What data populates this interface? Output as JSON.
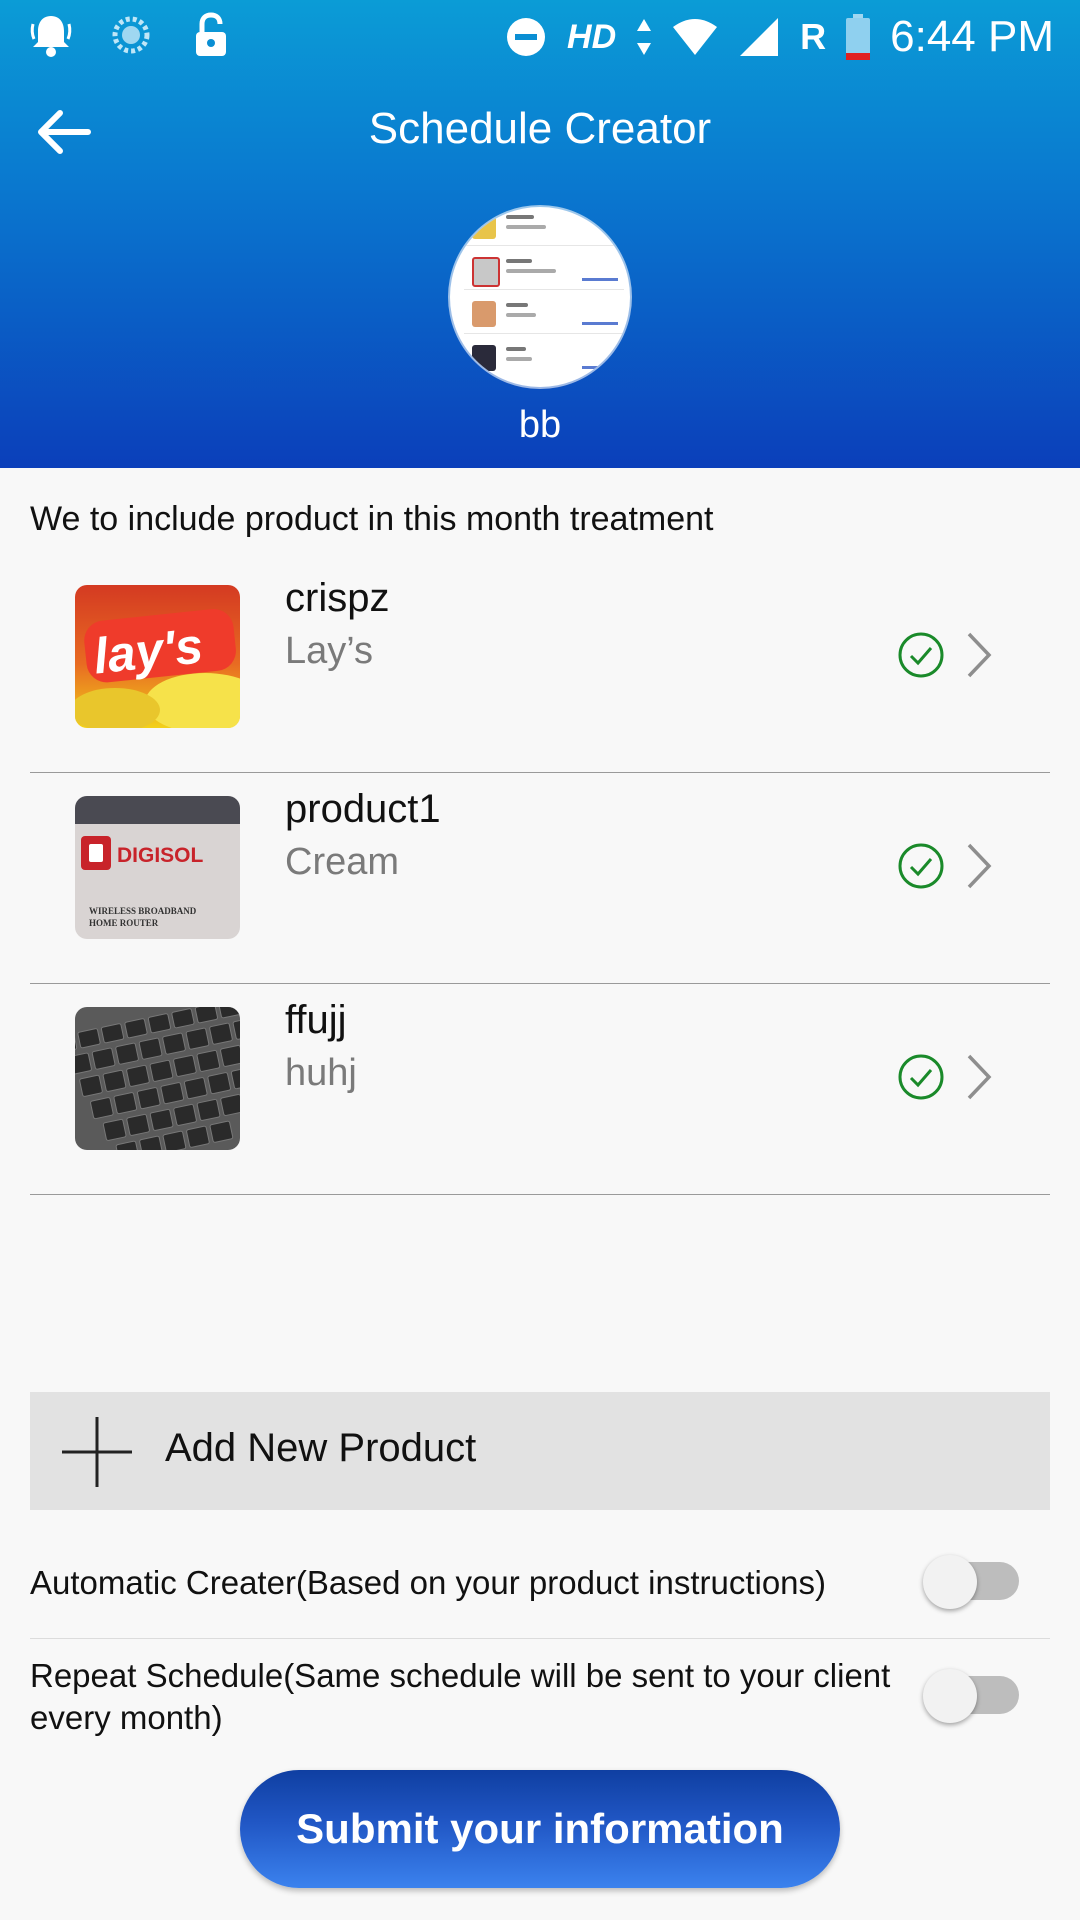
{
  "status_bar": {
    "hd_label": "HD",
    "roaming_label": "R",
    "time": "6:44 PM",
    "icons": [
      "notification-bell-icon",
      "sync-icon",
      "lock-icon",
      "do-not-disturb-icon",
      "data-arrows-icon",
      "wifi-icon",
      "signal-icon",
      "battery-icon"
    ]
  },
  "toolbar": {
    "title": "Schedule Creator",
    "back_icon": "arrow-left-icon"
  },
  "profile": {
    "username": "bb"
  },
  "intro_text": "We to include product in this month treatment",
  "products": [
    {
      "name": "crispz",
      "brand": "Lay’s",
      "selected": true,
      "status_icon": "check-circle-icon",
      "accent": "#e0302a"
    },
    {
      "name": "product1",
      "brand": "Cream",
      "selected": true,
      "status_icon": "check-circle-icon",
      "accent": "#c8232a"
    },
    {
      "name": "ffujj",
      "brand": "huhj",
      "selected": true,
      "status_icon": "check-circle-icon",
      "accent": "#3a3a3a"
    }
  ],
  "thumb_texts": {
    "lays": "lay's",
    "digisol": "DIGISOL",
    "router_line1": "WIRELESS BROADBAND",
    "router_line2": "HOME ROUTER"
  },
  "add_product": {
    "label": "Add New Product",
    "icon": "plus-icon"
  },
  "settings": {
    "automatic": {
      "label": "Automatic Creater(Based on your product instructions)",
      "enabled": false
    },
    "repeat": {
      "label": "Repeat Schedule(Same schedule will be sent to your client every month)",
      "enabled": false
    }
  },
  "submit_label": "Submit your information",
  "colors": {
    "header_top": "#0b9cd6",
    "header_bottom": "#0b3fba",
    "check_green": "#1a8a2a",
    "button_blue": "#2157c5"
  }
}
